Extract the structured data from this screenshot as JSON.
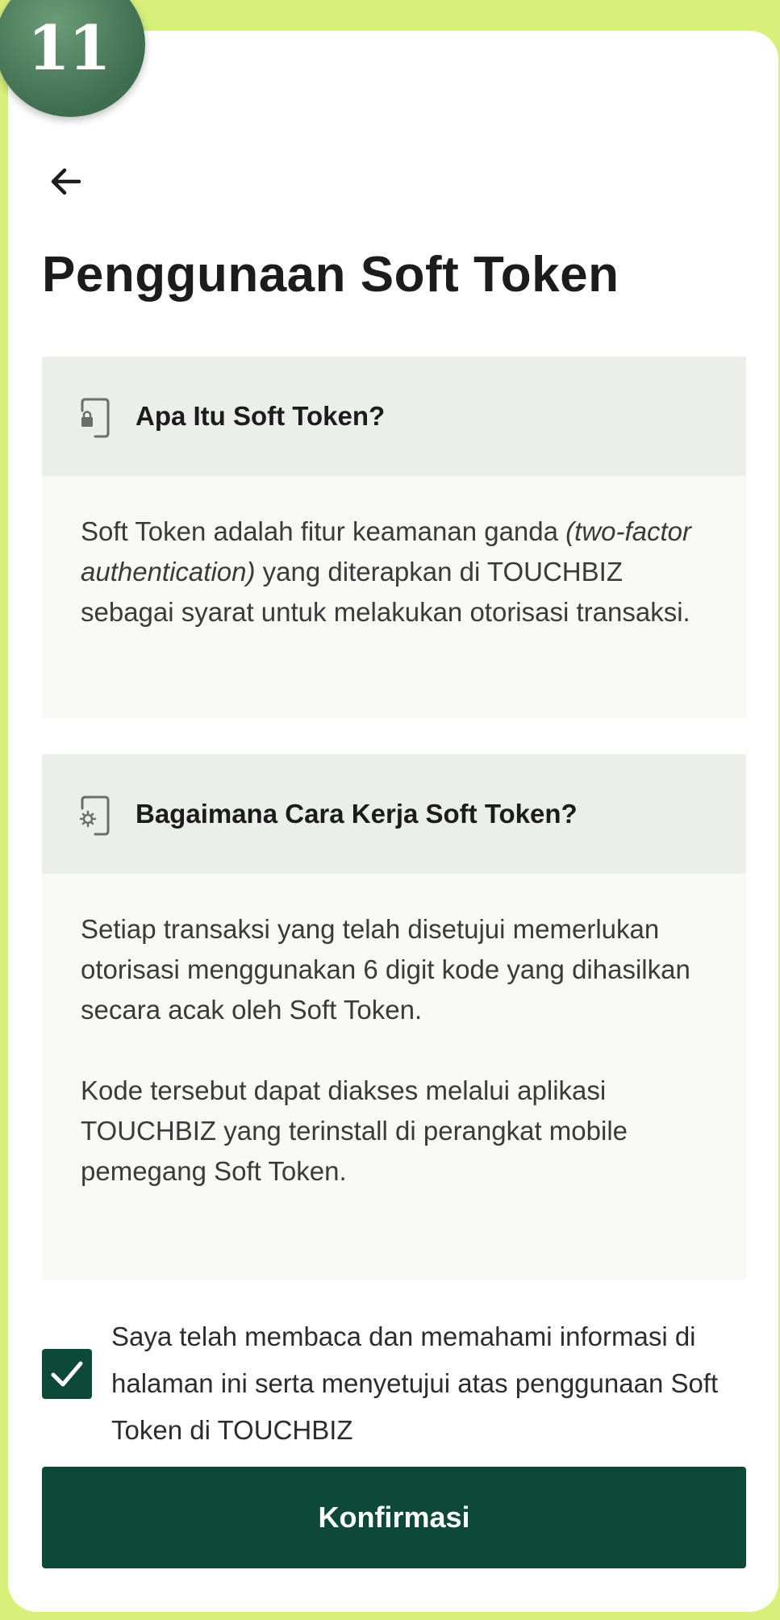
{
  "step_badge": "11",
  "header": {
    "back_icon": "arrow-left-icon",
    "title": "Penggunaan Soft Token"
  },
  "sections": [
    {
      "icon": "phone-lock-icon",
      "title": "Apa Itu Soft Token?",
      "body_parts": {
        "pre": "Soft Token adalah fitur keamanan ganda ",
        "em": "(two-factor authentication)",
        "post": " yang diterapkan di TOUCHBIZ sebagai syarat untuk melakukan otorisasi transaksi."
      }
    },
    {
      "icon": "phone-gear-icon",
      "title": "Bagaimana Cara Kerja Soft Token?",
      "paragraphs": [
        "Setiap transaksi yang telah disetujui memerlukan otorisasi menggunakan 6 digit kode yang dihasilkan secara acak oleh Soft Token.",
        "Kode tersebut dapat diakses melalui aplikasi TOUCHBIZ yang terinstall di perangkat mobile pemegang Soft Token."
      ]
    }
  ],
  "agreement": {
    "checked": true,
    "text": "Saya telah membaca dan memahami informasi di halaman ini serta menyetujui atas penggunaan Soft Token di TOUCHBIZ"
  },
  "confirm_button": {
    "label": "Konfirmasi"
  },
  "colors": {
    "background": "#d7f07a",
    "primary": "#0c4a37",
    "badge": "#4e7d5e",
    "section_header": "#eceeeb",
    "section_body": "#f8f8f6"
  }
}
